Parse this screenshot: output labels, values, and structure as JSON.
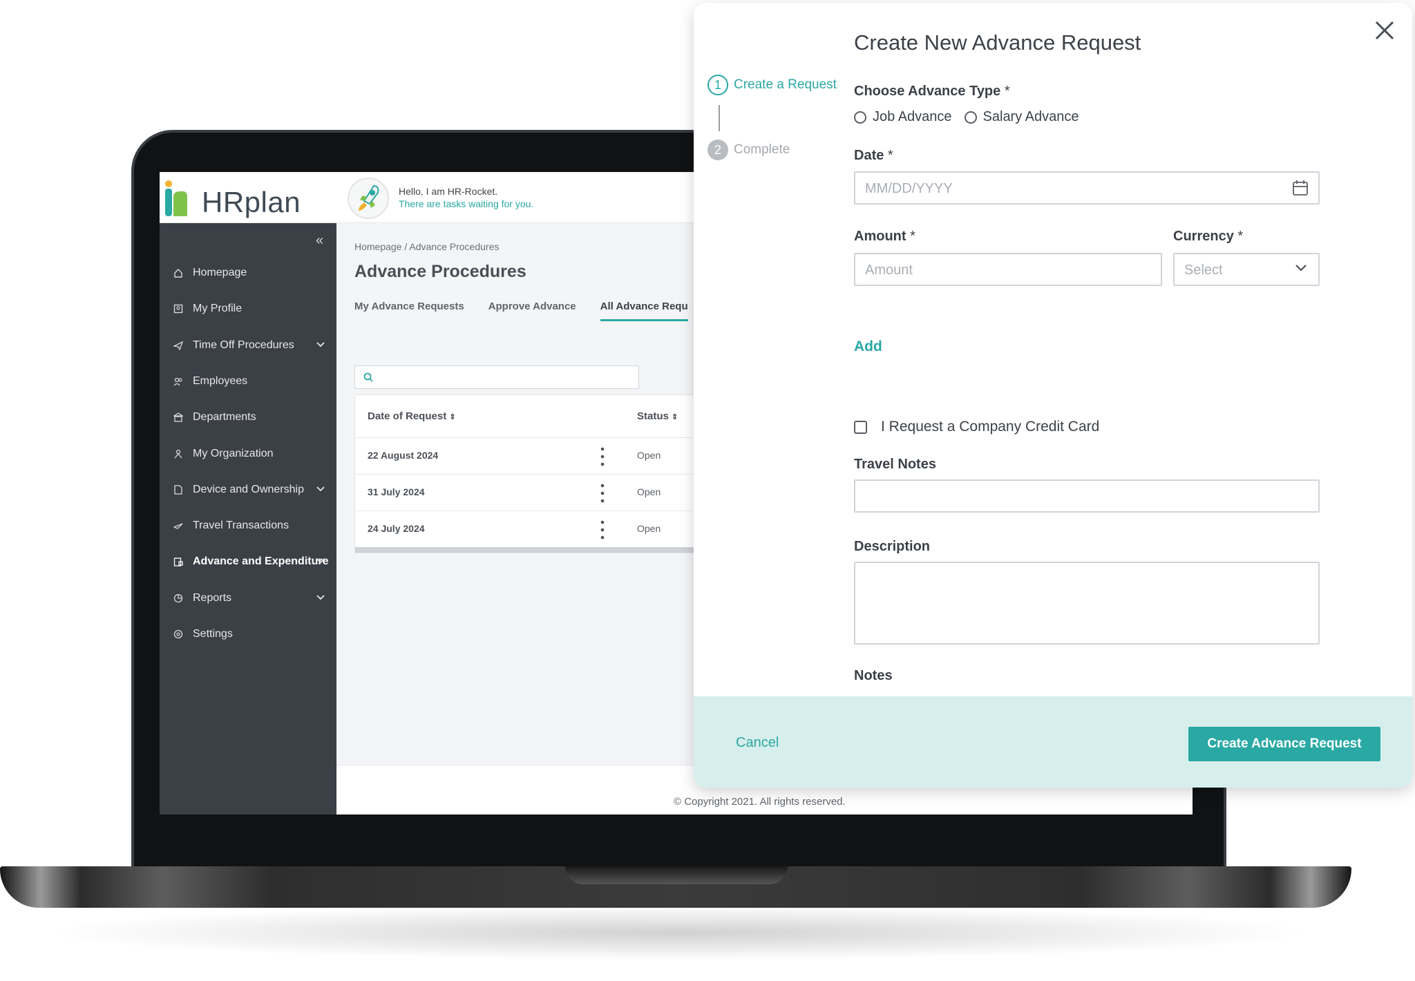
{
  "app": {
    "logo_text": "HRplan",
    "greeting": "Hello, I am HR-Rocket.",
    "tasks_message": "There are tasks waiting for you.",
    "collapse_glyph": "«"
  },
  "sidebar": {
    "items": [
      {
        "label": "Homepage",
        "icon": "home-icon",
        "expandable": false
      },
      {
        "label": "My Profile",
        "icon": "profile-icon",
        "expandable": false
      },
      {
        "label": "Time Off Procedures",
        "icon": "plane-icon",
        "expandable": true
      },
      {
        "label": "Employees",
        "icon": "users-icon",
        "expandable": false
      },
      {
        "label": "Departments",
        "icon": "building-icon",
        "expandable": false
      },
      {
        "label": "My Organization",
        "icon": "org-icon",
        "expandable": false
      },
      {
        "label": "Device and Ownership",
        "icon": "device-icon",
        "expandable": true
      },
      {
        "label": "Travel Transactions",
        "icon": "travel-icon",
        "expandable": false
      },
      {
        "label": "Advance and Expenditure",
        "icon": "wallet-icon",
        "expandable": true,
        "active": true
      },
      {
        "label": "Reports",
        "icon": "reports-icon",
        "expandable": true
      },
      {
        "label": "Settings",
        "icon": "settings-icon",
        "expandable": false
      }
    ]
  },
  "main": {
    "breadcrumb": "Homepage  /  Advance Procedures",
    "title": "Advance Procedures",
    "tabs": [
      {
        "label": "My Advance Requests",
        "active": false
      },
      {
        "label": "Approve Advance",
        "active": false
      },
      {
        "label": "All Advance Requ",
        "active": true
      }
    ],
    "search": {
      "value": "",
      "placeholder": ""
    },
    "table": {
      "columns": [
        "Date of Request",
        "Status"
      ],
      "rows": [
        {
          "date": "22 August 2024",
          "status": "Open"
        },
        {
          "date": "31 July 2024",
          "status": "Open"
        },
        {
          "date": "24 July 2024",
          "status": "Open"
        }
      ]
    },
    "copyright": "© Copyright 2021. All rights reserved."
  },
  "modal": {
    "title": "Create New Advance Request",
    "steps": [
      {
        "number": "1",
        "label": "Create a Request",
        "state": "active"
      },
      {
        "number": "2",
        "label": "Complete",
        "state": "pending"
      }
    ],
    "advance_type": {
      "label": "Choose Advance Type",
      "required_mark": "*",
      "options": [
        "Job Advance",
        "Salary Advance"
      ],
      "selected": null
    },
    "date": {
      "label": "Date",
      "required_mark": "*",
      "placeholder": "MM/DD/YYYY",
      "value": ""
    },
    "amount": {
      "label": "Amount",
      "required_mark": "*",
      "placeholder": "Amount",
      "value": ""
    },
    "currency": {
      "label": "Currency",
      "required_mark": "*",
      "placeholder": "Select",
      "value": ""
    },
    "add_link": "Add",
    "credit_card": {
      "label": "I Request a Company Credit Card",
      "checked": false
    },
    "travel_notes": {
      "label": "Travel Notes",
      "value": ""
    },
    "description": {
      "label": "Description",
      "value": ""
    },
    "notes": {
      "label": "Notes"
    },
    "footer": {
      "cancel_label": "Cancel",
      "submit_label": "Create Advance Request"
    }
  },
  "colors": {
    "accent": "#2aa8a4",
    "sidebar_bg": "#3b3f46",
    "footer_bg": "#d7efec",
    "text_dark": "#3c4148"
  }
}
